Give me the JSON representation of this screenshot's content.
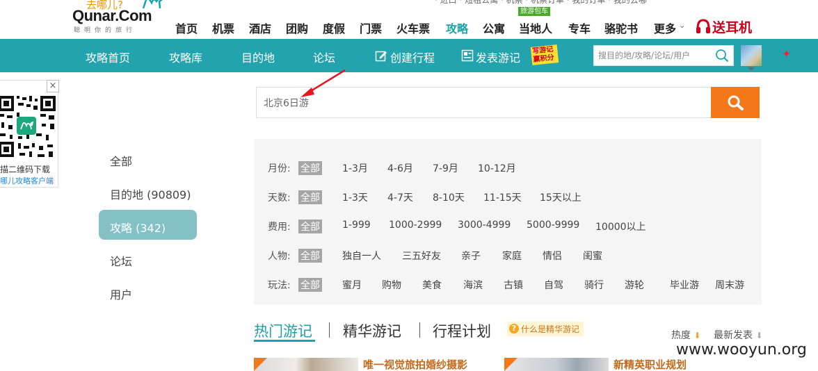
{
  "header": {
    "logo_text": "Qunar.Com",
    "logo_cn": "去哪儿?",
    "slogan": "聪明你的旅行",
    "nav": [
      "首页",
      "机票",
      "酒店",
      "团购",
      "度假",
      "门票",
      "火车票",
      "攻略",
      "公寓",
      "当地人",
      "专车",
      "骆驼书",
      "更多"
    ],
    "active_nav": "攻略",
    "badge": "旅游包车",
    "promo": "送耳机",
    "more_caret": "⌄"
  },
  "navbar": {
    "items": [
      "攻略首页",
      "攻略库",
      "目的地",
      "论坛",
      "创建行程",
      "发表游记"
    ],
    "promo_badge": "写游记赢积分",
    "search_placeholder": "搜目的地/攻略/论坛/用户"
  },
  "qr": {
    "close": "×",
    "text1": "描二维码下载",
    "text2": "哪儿攻略客户端"
  },
  "search": {
    "value": "北京6日游"
  },
  "categories": [
    "全部",
    "目的地 (90809)",
    "攻略 (342)",
    "论坛",
    "用户"
  ],
  "active_category": "攻略 (342)",
  "filters": {
    "month": {
      "label": "月份:",
      "options": [
        "全部",
        "1-3月",
        "4-6月",
        "7-9月",
        "10-12月"
      ]
    },
    "days": {
      "label": "天数:",
      "options": [
        "全部",
        "1-3天",
        "4-7天",
        "8-10天",
        "11-15天",
        "15天以上"
      ]
    },
    "cost": {
      "label": "费用:",
      "options": [
        "全部",
        "1-999",
        "1000-2999",
        "3000-4999",
        "5000-9999",
        "10000以上"
      ]
    },
    "people": {
      "label": "人物:",
      "options": [
        "全部",
        "独自一人",
        "三五好友",
        "亲子",
        "家庭",
        "情侣",
        "闺蜜"
      ]
    },
    "play": {
      "label": "玩法:",
      "options": [
        "全部",
        "蜜月",
        "购物",
        "美食",
        "海滨",
        "古镇",
        "自驾",
        "骑行",
        "游轮",
        "毕业游",
        "周末游"
      ]
    }
  },
  "tabs": [
    "热门游记",
    "精华游记",
    "行程计划"
  ],
  "hint": "什么是精华游记",
  "sort": {
    "hot": "热度",
    "latest": "最新发表"
  },
  "cards": [
    "唯一视觉旅拍婚纱摄影",
    "新精英职业规划"
  ],
  "watermark": "www.wooyun.org",
  "colors": {
    "teal": "#22a3ad",
    "orange": "#f47818",
    "gray_tag": "#a6a6a6"
  }
}
